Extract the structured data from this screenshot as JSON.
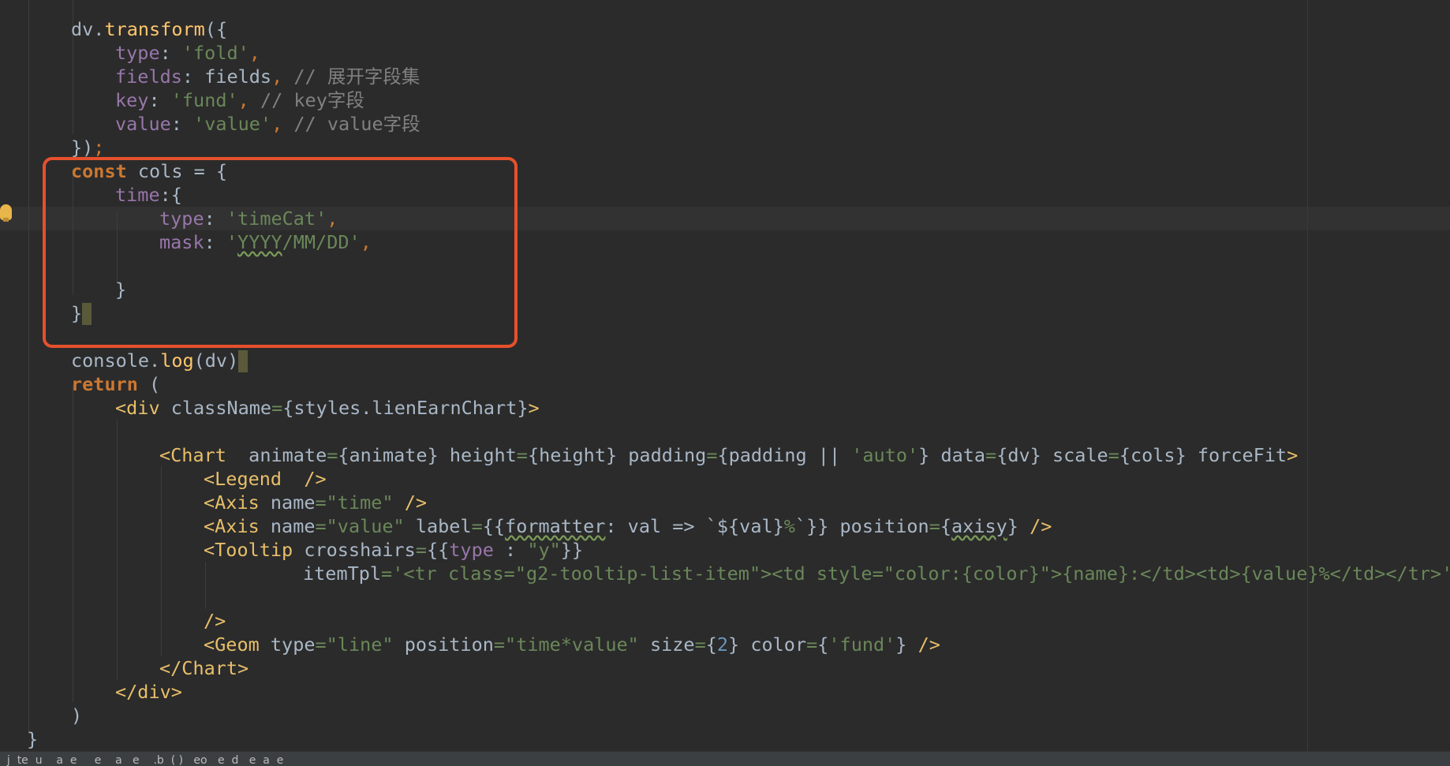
{
  "editor": {
    "l1": {
      "dv": "dv.",
      "fn": "transform",
      "open": "({"
    },
    "l2": {
      "key": "type",
      "colon": ": ",
      "val": "'fold'",
      "comma": ","
    },
    "l3": {
      "key": "fields",
      "colon": ": ",
      "ref": "fields",
      "comma": ",",
      "comment": "// 展开字段集"
    },
    "l4": {
      "key": "key",
      "colon": ": ",
      "val": "'fund'",
      "comma": ",",
      "comment": "// key字段"
    },
    "l5": {
      "key": "value",
      "colon": ": ",
      "val": "'value'",
      "comma": ",",
      "comment": "// value字段"
    },
    "l6": {
      "close": "})",
      "semi": ";"
    },
    "l7": {
      "kw": "const",
      "rest": " cols = {"
    },
    "l8": {
      "key": "time",
      "rest": ":{"
    },
    "l9": {
      "key": "type",
      "colon": ": ",
      "val": "'timeCat'",
      "comma": ","
    },
    "l10": {
      "key": "mask",
      "colon": ": ",
      "q1": "'",
      "w1": "YYYY",
      "w2": "/MM/DD",
      "q2": "'",
      "comma": ","
    },
    "l11": {
      "text": "}"
    },
    "l12": {
      "text": "}"
    },
    "l13": {
      "a": "console.",
      "fn": "log",
      "b": "(dv)"
    },
    "l14": {
      "kw": "return",
      "rest": " ("
    },
    "l15": {
      "tag": "<div",
      "attr": " className",
      "eq": "=",
      "v": "{styles.lienEarnChart}",
      "end": ">"
    },
    "l16": {
      "tag": "<Chart",
      "a1": "  animate",
      "v1": "{animate}",
      "a2": " height",
      "v2": "{height}",
      "a3": " padding",
      "v3a": "{padding || ",
      "v3s": "'auto'",
      "v3b": "}",
      "a4": " data",
      "v4": "{dv}",
      "a5": " scale",
      "v5": "{cols}",
      "a6": " forceFit",
      "end": ">"
    },
    "l17": {
      "tag": "<Legend",
      "end": "  />"
    },
    "l18": {
      "tag": "<Axis",
      "attr": " name",
      "v": "\"time\"",
      "end": " />"
    },
    "l19": {
      "tag": "<Axis",
      "a1": " name",
      "v1": "\"value\"",
      "a2": " label",
      "v2a": "{{",
      "v2w": "formatter",
      "v2b": ": val => `${val}",
      "v2pct": "%",
      "v2c": "`}}",
      "a3": " position",
      "v3a": "{",
      "v3w": "axisy",
      "v3b": "}",
      "end": " />"
    },
    "l20": {
      "tag": "<Tooltip",
      "attr": " crosshairs",
      "va": "{{",
      "vk": "type",
      "vb": " : ",
      "vs": "\"y\"",
      "vc": "}}"
    },
    "l21": {
      "attr": "itemTpl",
      "eq": "=",
      "v": "'<tr class=\"g2-tooltip-list-item\"><td style=\"color:{color}\">{name}:</td><td>{value}%</td></tr>'"
    },
    "l22": {
      "text": "/>"
    },
    "l23": {
      "tag": "<Geom",
      "a1": " type",
      "v1": "\"line\"",
      "a2": " position",
      "v2": "\"time*value\"",
      "a3": " size",
      "v3a": "{",
      "v3n": "2",
      "v3b": "}",
      "a4": " color",
      "v4a": "{",
      "v4s": "'fund'",
      "v4b": "}",
      "end": " />"
    },
    "l24": {
      "text": "</Chart>"
    },
    "l25": {
      "text": "</div>"
    },
    "l26": {
      "text": ")"
    },
    "l27": {
      "text": "}"
    }
  },
  "status": {
    "text": "  j  te  u    a  e     e    a   e    .b  ( )   eo   e  d   e  a  e"
  }
}
